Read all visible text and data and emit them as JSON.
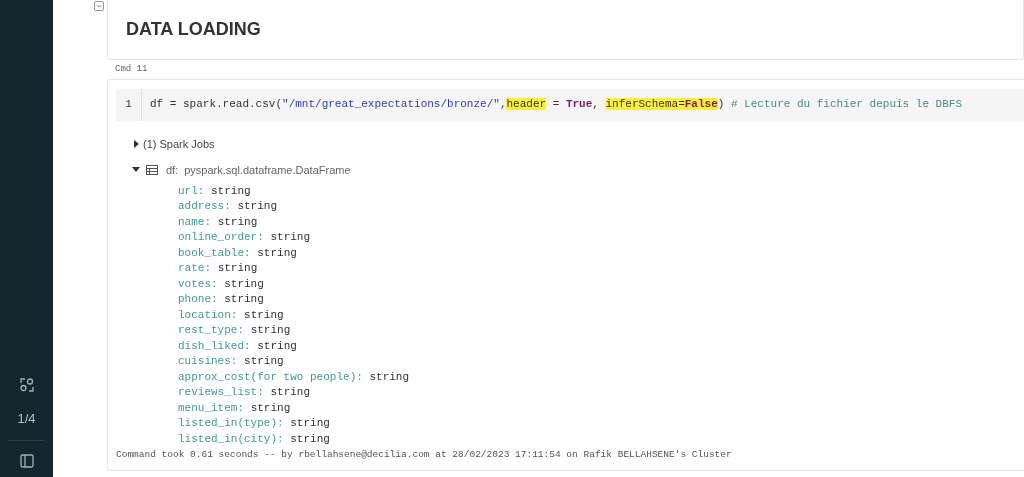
{
  "sidebar": {
    "page_indicator": "1/4"
  },
  "heading_cell": {
    "title": "DATA LOADING",
    "collapsed": false
  },
  "command_label": "Cmd 11",
  "code_cell": {
    "line_number": "1",
    "tokens": [
      {
        "kind": "plain",
        "text": "df = spark.read.csv(",
        "highlighted": false
      },
      {
        "kind": "string",
        "text": "\"/mnt/great_expectations/bronze/\"",
        "highlighted": false
      },
      {
        "kind": "plain",
        "text": ",",
        "highlighted": false
      },
      {
        "kind": "plain",
        "text": "header",
        "highlighted": true
      },
      {
        "kind": "plain",
        "text": " = ",
        "highlighted": false
      },
      {
        "kind": "keyword",
        "text": "True",
        "highlighted": false
      },
      {
        "kind": "plain",
        "text": ", ",
        "highlighted": false
      },
      {
        "kind": "plain",
        "text": "inferSchema=",
        "highlighted": true
      },
      {
        "kind": "keyword",
        "text": "False",
        "highlighted": true
      },
      {
        "kind": "plain",
        "text": ") ",
        "highlighted": false
      },
      {
        "kind": "comment",
        "text": "# Lecture du fichier depuis le DBFS",
        "highlighted": false
      }
    ]
  },
  "spark_jobs": {
    "label": "(1) Spark Jobs",
    "expanded": false
  },
  "dataframe": {
    "name": "df:",
    "type": "pyspark.sql.dataframe.DataFrame",
    "expanded": true,
    "fields": [
      {
        "name": "url:",
        "type": "string"
      },
      {
        "name": "address:",
        "type": "string"
      },
      {
        "name": "name:",
        "type": "string"
      },
      {
        "name": "online_order:",
        "type": "string"
      },
      {
        "name": "book_table:",
        "type": "string"
      },
      {
        "name": "rate:",
        "type": "string"
      },
      {
        "name": "votes:",
        "type": "string"
      },
      {
        "name": "phone:",
        "type": "string"
      },
      {
        "name": "location:",
        "type": "string"
      },
      {
        "name": "rest_type:",
        "type": "string"
      },
      {
        "name": "dish_liked:",
        "type": "string"
      },
      {
        "name": "cuisines:",
        "type": "string"
      },
      {
        "name": "approx_cost(for two people):",
        "type": "string"
      },
      {
        "name": "reviews_list:",
        "type": "string"
      },
      {
        "name": "menu_item:",
        "type": "string"
      },
      {
        "name": "listed_in(type):",
        "type": "string"
      },
      {
        "name": "listed_in(city):",
        "type": "string"
      }
    ]
  },
  "footer": "Command took 0.61 seconds -- by rbellahsene@decilia.com at 28/02/2023 17:11:54 on Rafik BELLAHSENE's Cluster"
}
